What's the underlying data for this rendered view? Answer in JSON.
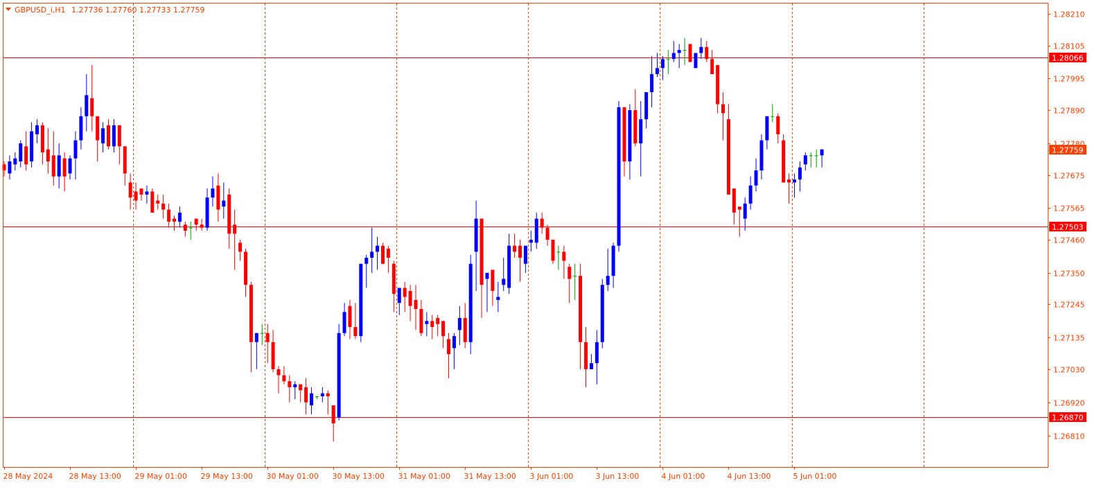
{
  "window": {
    "symbol_label": "GBPUSD_i,H1",
    "ohlc_label": "1.27736 1.27760 1.27733 1.27759"
  },
  "colors": {
    "background": "#ffffff",
    "frame": "#ff4000",
    "axis_text": "#ff4000",
    "grid": "#ff4000",
    "bull": "#0000ff",
    "bear": "#ff0000",
    "doji": "#00a000",
    "level_line": "#ff0000",
    "price_tag_bg": "#ff0000",
    "current_tag_bg": "#ff4000",
    "tag_text": "#ffffff"
  },
  "chart_data": {
    "type": "candlestick",
    "timeframe": "H1",
    "y_tick_labels": [
      "1.28210",
      "1.28105",
      "1.27995",
      "1.27890",
      "1.27780",
      "1.27675",
      "1.27565",
      "1.27460",
      "1.27350",
      "1.27245",
      "1.27135",
      "1.27030",
      "1.26920",
      "1.26810"
    ],
    "y_ticks": [
      1.2821,
      1.28105,
      1.27995,
      1.2789,
      1.2778,
      1.27675,
      1.27565,
      1.2746,
      1.2735,
      1.27245,
      1.27135,
      1.2703,
      1.2692,
      1.2681
    ],
    "ylim": [
      1.26788,
      1.28235
    ],
    "x_tick_labels": [
      "28 May 2024",
      "28 May 13:00",
      "29 May 01:00",
      "29 May 13:00",
      "30 May 01:00",
      "30 May 13:00",
      "31 May 01:00",
      "31 May 13:00",
      "3 Jun 01:00",
      "3 Jun 13:00",
      "4 Jun 01:00",
      "4 Jun 13:00",
      "5 Jun 01:00"
    ],
    "x_tick_bar_index": [
      0,
      12,
      24,
      36,
      48,
      60,
      72,
      84,
      96,
      108,
      120,
      132,
      144
    ],
    "period_separators_bar_index": [
      23,
      47,
      71,
      95,
      119,
      143,
      167
    ],
    "horizontal_levels": [
      {
        "price": 1.28066,
        "label": "1.28066"
      },
      {
        "price": 1.27503,
        "label": "1.27503"
      },
      {
        "price": 1.2687,
        "label": "1.26870"
      }
    ],
    "current_price": {
      "price": 1.27759,
      "label": "1.27759"
    },
    "bar_count_visible": 152,
    "ohlc": [
      [
        1.2771,
        1.2772,
        1.2767,
        1.2769
      ],
      [
        1.2768,
        1.2774,
        1.2766,
        1.2772
      ],
      [
        1.2771,
        1.2775,
        1.2769,
        1.2773
      ],
      [
        1.2772,
        1.2779,
        1.277,
        1.2778
      ],
      [
        1.2777,
        1.2782,
        1.2769,
        1.2771
      ],
      [
        1.2772,
        1.2785,
        1.277,
        1.2782
      ],
      [
        1.2781,
        1.2786,
        1.2778,
        1.2784
      ],
      [
        1.2784,
        1.2785,
        1.2771,
        1.2775
      ],
      [
        1.2776,
        1.2783,
        1.2768,
        1.2772
      ],
      [
        1.2774,
        1.2782,
        1.2764,
        1.2767
      ],
      [
        1.2767,
        1.2778,
        1.2763,
        1.2774
      ],
      [
        1.2773,
        1.2775,
        1.2762,
        1.2767
      ],
      [
        1.2768,
        1.2774,
        1.2766,
        1.2773
      ],
      [
        1.2773,
        1.2782,
        1.2766,
        1.2779
      ],
      [
        1.2779,
        1.279,
        1.2776,
        1.2787
      ],
      [
        1.2787,
        1.2801,
        1.2782,
        1.2794
      ],
      [
        1.2793,
        1.2804,
        1.2782,
        1.2787
      ],
      [
        1.2787,
        1.2786,
        1.2772,
        1.2779
      ],
      [
        1.2778,
        1.2785,
        1.2775,
        1.2783
      ],
      [
        1.2784,
        1.2786,
        1.2776,
        1.2777
      ],
      [
        1.2777,
        1.2786,
        1.2775,
        1.2784
      ],
      [
        1.2784,
        1.2782,
        1.2771,
        1.2777
      ],
      [
        1.2777,
        1.2777,
        1.2764,
        1.2768
      ],
      [
        1.2765,
        1.2768,
        1.2756,
        1.276
      ],
      [
        1.2762,
        1.2765,
        1.2756,
        1.2759
      ],
      [
        1.2763,
        1.2763,
        1.2759,
        1.2761
      ],
      [
        1.2761,
        1.2764,
        1.2758,
        1.2762
      ],
      [
        1.2762,
        1.2763,
        1.2755,
        1.2755
      ],
      [
        1.2759,
        1.2761,
        1.2756,
        1.2758
      ],
      [
        1.2758,
        1.2761,
        1.2753,
        1.2756
      ],
      [
        1.2756,
        1.2758,
        1.275,
        1.2752
      ],
      [
        1.2753,
        1.2754,
        1.2749,
        1.2752
      ],
      [
        1.2752,
        1.2757,
        1.275,
        1.2755
      ],
      [
        1.2751,
        1.2752,
        1.2747,
        1.2749
      ],
      [
        1.275,
        1.2752,
        1.2746,
        1.275
      ],
      [
        1.2753,
        1.2753,
        1.2749,
        1.2751
      ],
      [
        1.2751,
        1.2753,
        1.2749,
        1.275
      ],
      [
        1.275,
        1.2763,
        1.2749,
        1.276
      ],
      [
        1.276,
        1.2767,
        1.2757,
        1.2763
      ],
      [
        1.2764,
        1.2768,
        1.2752,
        1.2756
      ],
      [
        1.2757,
        1.2765,
        1.2753,
        1.2759
      ],
      [
        1.2761,
        1.2763,
        1.2743,
        1.2748
      ],
      [
        1.2751,
        1.2756,
        1.2736,
        1.2748
      ],
      [
        1.2745,
        1.2746,
        1.2739,
        1.2742
      ],
      [
        1.2742,
        1.2743,
        1.2727,
        1.2731
      ],
      [
        1.2731,
        1.2732,
        1.2702,
        1.2712
      ],
      [
        1.2712,
        1.2714,
        1.2703,
        1.2715
      ],
      [
        1.2715,
        1.2718,
        1.2711,
        1.2715
      ],
      [
        1.2715,
        1.2718,
        1.2705,
        1.2712
      ],
      [
        1.2712,
        1.2716,
        1.2702,
        1.2703
      ],
      [
        1.2703,
        1.2704,
        1.2695,
        1.2701
      ],
      [
        1.2701,
        1.2704,
        1.2698,
        1.2699
      ],
      [
        1.2699,
        1.2701,
        1.2692,
        1.2697
      ],
      [
        1.2697,
        1.2699,
        1.2693,
        1.2698
      ],
      [
        1.2698,
        1.2698,
        1.2692,
        1.2696
      ],
      [
        1.2697,
        1.27,
        1.2688,
        1.2692
      ],
      [
        1.2691,
        1.2697,
        1.2688,
        1.2695
      ],
      [
        1.2694,
        1.2694,
        1.2693,
        1.2694
      ],
      [
        1.2694,
        1.2697,
        1.2692,
        1.2695
      ],
      [
        1.2695,
        1.2696,
        1.2688,
        1.2694
      ],
      [
        1.2691,
        1.2691,
        1.2679,
        1.2685
      ],
      [
        1.2687,
        1.2718,
        1.2686,
        1.2715
      ],
      [
        1.2715,
        1.2725,
        1.2714,
        1.2722
      ],
      [
        1.2724,
        1.2726,
        1.2713,
        1.2717
      ],
      [
        1.2717,
        1.2725,
        1.2713,
        1.2714
      ],
      [
        1.2714,
        1.2737,
        1.2712,
        1.2738
      ],
      [
        1.2738,
        1.2741,
        1.273,
        1.274
      ],
      [
        1.274,
        1.275,
        1.2735,
        1.2742
      ],
      [
        1.2742,
        1.2747,
        1.2736,
        1.2744
      ],
      [
        1.2744,
        1.2745,
        1.2738,
        1.2738
      ],
      [
        1.2743,
        1.2744,
        1.2735,
        1.274
      ],
      [
        1.2738,
        1.2739,
        1.2722,
        1.2728
      ],
      [
        1.2725,
        1.2728,
        1.2721,
        1.273
      ],
      [
        1.273,
        1.2732,
        1.2722,
        1.2727
      ],
      [
        1.2729,
        1.2731,
        1.2719,
        1.2724
      ],
      [
        1.2726,
        1.2731,
        1.2716,
        1.2723
      ],
      [
        1.2723,
        1.2726,
        1.2714,
        1.2715
      ],
      [
        1.2718,
        1.2722,
        1.2714,
        1.2719
      ],
      [
        1.2719,
        1.2721,
        1.2713,
        1.2717
      ],
      [
        1.272,
        1.2721,
        1.2714,
        1.2718
      ],
      [
        1.2719,
        1.2719,
        1.271,
        1.2714
      ],
      [
        1.2713,
        1.2715,
        1.27,
        1.2708
      ],
      [
        1.271,
        1.2715,
        1.2703,
        1.2714
      ],
      [
        1.2716,
        1.2724,
        1.2711,
        1.272
      ],
      [
        1.272,
        1.2725,
        1.271,
        1.2712
      ],
      [
        1.2712,
        1.2741,
        1.2708,
        1.2738
      ],
      [
        1.2742,
        1.2759,
        1.2729,
        1.2753
      ],
      [
        1.2753,
        1.2747,
        1.272,
        1.2731
      ],
      [
        1.2733,
        1.2735,
        1.2722,
        1.2735
      ],
      [
        1.2736,
        1.2736,
        1.2724,
        1.2729
      ],
      [
        1.2726,
        1.2732,
        1.2722,
        1.2727
      ],
      [
        1.2731,
        1.274,
        1.2729,
        1.2733
      ],
      [
        1.273,
        1.2748,
        1.2728,
        1.2744
      ],
      [
        1.2744,
        1.2748,
        1.274,
        1.2742
      ],
      [
        1.2744,
        1.2746,
        1.2732,
        1.274
      ],
      [
        1.2738,
        1.2744,
        1.2735,
        1.2744
      ],
      [
        1.2745,
        1.2749,
        1.2742,
        1.2746
      ],
      [
        1.2745,
        1.2755,
        1.2743,
        1.2753
      ],
      [
        1.2753,
        1.2755,
        1.2748,
        1.275
      ],
      [
        1.275,
        1.2751,
        1.2744,
        1.2746
      ],
      [
        1.2746,
        1.2746,
        1.2738,
        1.2739
      ],
      [
        1.2742,
        1.2744,
        1.2736,
        1.2742
      ],
      [
        1.2742,
        1.2744,
        1.2733,
        1.2739
      ],
      [
        1.2737,
        1.2738,
        1.2725,
        1.2733
      ],
      [
        1.2734,
        1.2738,
        1.2726,
        1.2734
      ],
      [
        1.2734,
        1.2738,
        1.2703,
        1.2712
      ],
      [
        1.2712,
        1.2717,
        1.2697,
        1.2703
      ],
      [
        1.2703,
        1.2708,
        1.2705,
        1.2705
      ],
      [
        1.2705,
        1.2716,
        1.2698,
        1.2712
      ],
      [
        1.2712,
        1.2733,
        1.271,
        1.2731
      ],
      [
        1.2731,
        1.2743,
        1.2729,
        1.2734
      ],
      [
        1.2734,
        1.2745,
        1.273,
        1.2744
      ],
      [
        1.2744,
        1.2792,
        1.2742,
        1.279
      ],
      [
        1.279,
        1.2787,
        1.2767,
        1.2772
      ],
      [
        1.2772,
        1.2791,
        1.2766,
        1.2789
      ],
      [
        1.2789,
        1.2796,
        1.2777,
        1.2778
      ],
      [
        1.2778,
        1.2792,
        1.2767,
        1.2786
      ],
      [
        1.2786,
        1.2795,
        1.2783,
        1.2795
      ],
      [
        1.2795,
        1.2807,
        1.279,
        1.2801
      ],
      [
        1.2801,
        1.2808,
        1.28,
        1.2803
      ],
      [
        1.2803,
        1.2807,
        1.2799,
        1.2806
      ],
      [
        1.2806,
        1.2809,
        1.2801,
        1.2806
      ],
      [
        1.2806,
        1.2812,
        1.2805,
        1.2808
      ],
      [
        1.2808,
        1.2811,
        1.2803,
        1.2809
      ],
      [
        1.2809,
        1.2813,
        1.2804,
        1.2809
      ],
      [
        1.2811,
        1.2808,
        1.2806,
        1.2805
      ],
      [
        1.2803,
        1.2808,
        1.2804,
        1.2808
      ],
      [
        1.2808,
        1.2813,
        1.2806,
        1.281
      ],
      [
        1.281,
        1.2812,
        1.2805,
        1.2806
      ],
      [
        1.2806,
        1.2809,
        1.2801,
        1.2801
      ],
      [
        1.2804,
        1.2802,
        1.2788,
        1.2791
      ],
      [
        1.2791,
        1.2795,
        1.2779,
        1.2788
      ],
      [
        1.2786,
        1.2791,
        1.2771,
        1.2761
      ],
      [
        1.2763,
        1.2763,
        1.2751,
        1.2755
      ],
      [
        1.2757,
        1.2756,
        1.2747,
        1.2756
      ],
      [
        1.2753,
        1.276,
        1.2749,
        1.2758
      ],
      [
        1.2758,
        1.2767,
        1.2756,
        1.2764
      ],
      [
        1.2764,
        1.2773,
        1.2762,
        1.2769
      ],
      [
        1.2769,
        1.2781,
        1.2766,
        1.2779
      ],
      [
        1.2779,
        1.2785,
        1.2776,
        1.2787
      ],
      [
        1.2787,
        1.2791,
        1.2785,
        1.2787
      ],
      [
        1.2787,
        1.2788,
        1.2778,
        1.2781
      ],
      [
        1.2779,
        1.2781,
        1.2766,
        1.2765
      ],
      [
        1.2766,
        1.2768,
        1.2758,
        1.2765
      ],
      [
        1.2765,
        1.2768,
        1.276,
        1.2766
      ],
      [
        1.2766,
        1.2772,
        1.2762,
        1.277
      ],
      [
        1.2771,
        1.2775,
        1.2769,
        1.2774
      ],
      [
        1.2774,
        1.2775,
        1.277,
        1.2774
      ],
      [
        1.2774,
        1.2776,
        1.277,
        1.2774
      ],
      [
        1.2774,
        1.2776,
        1.277,
        1.2776
      ]
    ]
  }
}
